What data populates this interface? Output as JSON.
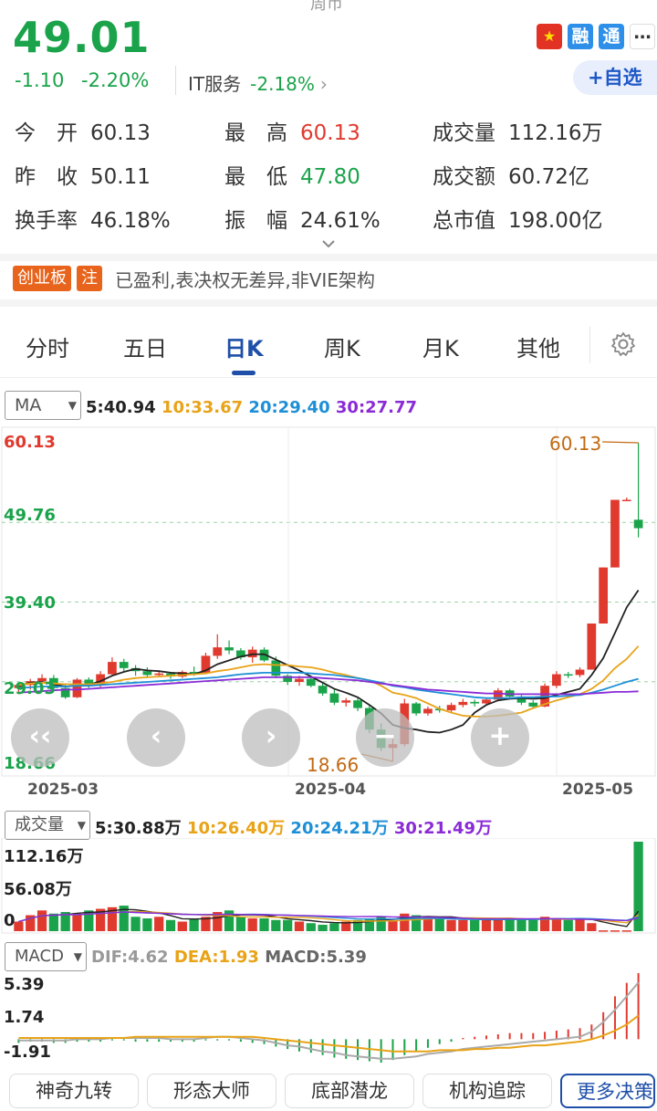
{
  "header": {
    "top_label": "周币",
    "price": "49.01",
    "change": "-1.10",
    "change_pct": "-2.20%",
    "sector_name": "IT服务",
    "sector_pct": "-2.18%",
    "sector_arrow": "›",
    "badge_rong": "融",
    "badge_tong": "通",
    "add_watchlist": "+自选"
  },
  "stats": {
    "open_label": "今　开",
    "open": "60.13",
    "high_label": "最　高",
    "high": "60.13",
    "volume_label": "成交量",
    "volume": "112.16万",
    "prev_label": "昨　收",
    "prev": "50.11",
    "low_label": "最　低",
    "low": "47.80",
    "amount_label": "成交额",
    "amount": "60.72亿",
    "turnover_label": "换手率",
    "turnover": "46.18%",
    "amplitude_label": "振　幅",
    "amplitude": "24.61%",
    "mktcap_label": "总市值",
    "mktcap": "198.00亿"
  },
  "board": {
    "tag1": "创业板",
    "tag2": "注",
    "text": "已盈利,表决权无差异,非VIE架构"
  },
  "tabs": [
    "分时",
    "五日",
    "日K",
    "周K",
    "月K",
    "其他"
  ],
  "ma_panel": {
    "selector": "MA",
    "ma5": "5:40.94",
    "ma10": "10:33.67",
    "ma20": "20:29.40",
    "ma30": "30:27.77"
  },
  "colors": {
    "up": "#e03a2f",
    "down": "#1aa34a",
    "ma5": "#222222",
    "ma10": "#e8a317",
    "ma20": "#1e8fd6",
    "ma30": "#8a2bd6"
  },
  "vol_panel": {
    "selector": "成交量",
    "ma5": "5:30.88万",
    "ma10": "10:26.40万",
    "ma20": "20:24.21万",
    "ma30": "30:21.49万",
    "ymax": "112.16万",
    "ymid": "56.08万",
    "ymin": "0"
  },
  "macd_panel": {
    "selector": "MACD",
    "dif": "DIF:4.62",
    "dea": "DEA:1.93",
    "macd": "MACD:5.39",
    "ymax": "5.39",
    "ymid": "1.74",
    "ymin": "-1.91"
  },
  "bottom_tabs": [
    "神奇九转",
    "形态大师",
    "底部潜龙",
    "机构追踪",
    "更多决策"
  ],
  "chart_data": {
    "type": "candlestick",
    "y_axis_labels": [
      "60.13",
      "49.76",
      "39.40",
      "29.03",
      "18.66"
    ],
    "ylim": [
      18.66,
      60.13
    ],
    "x_ticks": [
      "2025-03",
      "2025-04",
      "2025-05"
    ],
    "annotations": {
      "max": "60.13",
      "min": "18.66"
    },
    "candles": [
      [
        28.2,
        28.9,
        27.4,
        28.6
      ],
      [
        28.6,
        29.4,
        28.0,
        29.1
      ],
      [
        29.1,
        30.0,
        28.5,
        29.5
      ],
      [
        29.5,
        29.9,
        27.9,
        28.2
      ],
      [
        28.2,
        28.8,
        26.8,
        27.0
      ],
      [
        27.0,
        29.5,
        26.9,
        29.3
      ],
      [
        29.3,
        29.6,
        28.2,
        28.6
      ],
      [
        28.6,
        30.4,
        28.3,
        30.0
      ],
      [
        30.0,
        32.2,
        29.8,
        31.6
      ],
      [
        31.6,
        32.0,
        30.4,
        30.8
      ],
      [
        30.8,
        31.2,
        29.8,
        30.4
      ],
      [
        30.4,
        30.9,
        29.5,
        29.9
      ],
      [
        29.9,
        30.5,
        29.6,
        30.1
      ],
      [
        30.1,
        30.3,
        29.4,
        29.7
      ],
      [
        29.7,
        30.5,
        29.5,
        30.3
      ],
      [
        30.3,
        31.0,
        29.8,
        30.2
      ],
      [
        30.2,
        32.8,
        30.0,
        32.4
      ],
      [
        32.4,
        35.2,
        32.0,
        33.5
      ],
      [
        33.5,
        34.4,
        32.6,
        33.1
      ],
      [
        33.1,
        33.4,
        31.9,
        32.2
      ],
      [
        32.2,
        33.6,
        31.5,
        33.2
      ],
      [
        33.2,
        33.5,
        31.6,
        31.8
      ],
      [
        31.8,
        32.3,
        29.5,
        29.8
      ],
      [
        29.8,
        30.0,
        28.6,
        29.0
      ],
      [
        29.0,
        29.8,
        28.5,
        29.4
      ],
      [
        29.4,
        29.6,
        28.3,
        28.5
      ],
      [
        28.5,
        28.8,
        27.2,
        27.5
      ],
      [
        27.5,
        28.0,
        26.0,
        26.3
      ],
      [
        26.3,
        26.9,
        25.8,
        26.6
      ],
      [
        26.6,
        26.9,
        25.2,
        25.6
      ],
      [
        25.6,
        25.9,
        22.3,
        22.8
      ],
      [
        22.8,
        23.6,
        20.0,
        20.4
      ],
      [
        20.4,
        21.6,
        18.66,
        20.9
      ],
      [
        20.9,
        26.8,
        20.6,
        26.2
      ],
      [
        26.2,
        26.4,
        24.6,
        24.9
      ],
      [
        24.9,
        25.8,
        24.6,
        25.5
      ],
      [
        25.5,
        25.9,
        25.0,
        25.3
      ],
      [
        25.3,
        26.3,
        25.1,
        26.0
      ],
      [
        26.0,
        26.8,
        25.7,
        26.4
      ],
      [
        26.4,
        26.7,
        25.8,
        26.2
      ],
      [
        26.2,
        26.9,
        26.0,
        26.7
      ],
      [
        26.7,
        28.2,
        26.5,
        27.9
      ],
      [
        27.9,
        28.1,
        26.9,
        27.1
      ],
      [
        27.1,
        27.3,
        26.0,
        26.3
      ],
      [
        26.3,
        26.6,
        25.6,
        25.8
      ],
      [
        25.8,
        28.8,
        25.7,
        28.5
      ],
      [
        28.5,
        30.4,
        28.2,
        30.0
      ],
      [
        30.0,
        30.3,
        29.5,
        29.9
      ],
      [
        29.9,
        30.9,
        29.6,
        30.6
      ],
      [
        30.6,
        36.6,
        30.6,
        36.6
      ],
      [
        36.6,
        43.9,
        36.6,
        43.9
      ],
      [
        43.9,
        52.7,
        43.9,
        52.7
      ],
      [
        52.7,
        53.0,
        52.6,
        52.7
      ],
      [
        50.11,
        60.13,
        47.8,
        49.01
      ]
    ],
    "ma_lines": {
      "ma5": [
        28.5,
        28.9,
        29.0,
        28.7,
        28.4,
        28.5,
        28.6,
        29.1,
        29.8,
        30.3,
        30.7,
        30.5,
        30.4,
        30.2,
        30.1,
        30.0,
        30.5,
        31.3,
        31.8,
        32.3,
        32.6,
        32.6,
        31.9,
        31.2,
        30.5,
        29.7,
        28.9,
        28.1,
        27.6,
        27.0,
        26.0,
        24.9,
        23.4,
        23.0,
        22.8,
        22.5,
        22.4,
        22.8,
        23.4,
        25.0,
        26.0,
        26.6,
        26.8,
        26.9,
        26.8,
        26.9,
        27.3,
        27.7,
        28.1,
        29.9,
        32.1,
        35.4,
        38.7,
        40.94
      ],
      "ma10": [
        28.6,
        28.8,
        28.9,
        28.8,
        28.7,
        28.7,
        28.7,
        28.8,
        29.0,
        29.3,
        29.5,
        29.6,
        29.7,
        29.8,
        29.9,
        30.0,
        30.1,
        30.4,
        30.6,
        30.9,
        31.2,
        31.3,
        31.2,
        31.2,
        31.0,
        30.9,
        30.6,
        30.2,
        29.9,
        29.5,
        29.2,
        28.5,
        27.6,
        27.3,
        26.9,
        26.2,
        25.5,
        25.0,
        24.6,
        24.5,
        24.5,
        24.6,
        24.8,
        25.0,
        25.6,
        26.1,
        26.6,
        27.0,
        27.4,
        28.1,
        29.2,
        30.8,
        32.0,
        33.67
      ],
      "ma20": [
        28.2,
        28.3,
        28.4,
        28.4,
        28.4,
        28.5,
        28.5,
        28.6,
        28.7,
        28.8,
        28.9,
        29.0,
        29.1,
        29.2,
        29.3,
        29.4,
        29.5,
        29.6,
        29.8,
        30.0,
        30.1,
        30.2,
        30.2,
        30.2,
        30.2,
        30.1,
        30.0,
        29.9,
        29.7,
        29.5,
        29.2,
        28.9,
        28.5,
        28.3,
        28.0,
        27.8,
        27.6,
        27.4,
        27.2,
        27.0,
        26.9,
        26.9,
        26.9,
        27.0,
        27.0,
        27.1,
        27.1,
        27.2,
        27.3,
        27.6,
        28.0,
        28.5,
        29.0,
        29.4
      ],
      "ma30": [
        27.6,
        27.7,
        27.8,
        27.9,
        28.0,
        28.0,
        28.1,
        28.2,
        28.3,
        28.4,
        28.5,
        28.6,
        28.7,
        28.8,
        28.9,
        29.0,
        29.1,
        29.2,
        29.3,
        29.4,
        29.5,
        29.6,
        29.6,
        29.6,
        29.6,
        29.6,
        29.5,
        29.4,
        29.3,
        29.2,
        29.0,
        28.8,
        28.6,
        28.4,
        28.2,
        28.0,
        27.9,
        27.8,
        27.7,
        27.6,
        27.5,
        27.5,
        27.4,
        27.4,
        27.4,
        27.4,
        27.4,
        27.4,
        27.4,
        27.5,
        27.6,
        27.7,
        27.7,
        27.77
      ]
    },
    "volume": [
      12,
      20,
      26,
      22,
      24,
      20,
      26,
      28,
      30,
      32,
      18,
      16,
      18,
      14,
      12,
      16,
      18,
      24,
      26,
      18,
      16,
      16,
      14,
      14,
      12,
      10,
      8,
      10,
      12,
      14,
      16,
      18,
      14,
      22,
      20,
      18,
      16,
      14,
      14,
      14,
      14,
      16,
      16,
      14,
      14,
      18,
      16,
      14,
      16,
      10,
      1,
      1,
      1,
      112.16
    ],
    "macd_hist": [
      -0.3,
      -0.2,
      -0.2,
      -0.3,
      -0.3,
      -0.2,
      -0.2,
      -0.2,
      -0.1,
      -0.1,
      -0.2,
      -0.2,
      -0.2,
      -0.2,
      -0.2,
      -0.2,
      -0.1,
      -0.1,
      -0.1,
      -0.2,
      -0.3,
      -0.4,
      -0.6,
      -0.8,
      -1.0,
      -1.1,
      -1.3,
      -1.5,
      -1.6,
      -1.7,
      -1.8,
      -1.91,
      -1.7,
      -1.3,
      -1.0,
      -0.7,
      -0.4,
      -0.2,
      0.1,
      0.2,
      0.3,
      0.4,
      0.5,
      0.5,
      0.5,
      0.6,
      0.7,
      0.8,
      0.9,
      1.2,
      2.2,
      3.5,
      4.6,
      5.39
    ],
    "dif": [
      -0.1,
      -0.1,
      -0.1,
      -0.1,
      -0.1,
      0.0,
      0.0,
      0.0,
      0.1,
      0.1,
      0.1,
      0.1,
      0.1,
      0.0,
      0.0,
      0.0,
      0.1,
      0.2,
      0.2,
      0.1,
      0.0,
      -0.1,
      -0.3,
      -0.5,
      -0.6,
      -0.8,
      -1.0,
      -1.1,
      -1.3,
      -1.4,
      -1.5,
      -1.6,
      -1.6,
      -1.5,
      -1.4,
      -1.2,
      -1.1,
      -1.0,
      -0.8,
      -0.7,
      -0.6,
      -0.5,
      -0.4,
      -0.3,
      -0.2,
      -0.1,
      0.0,
      0.1,
      0.2,
      0.6,
      1.4,
      2.4,
      3.5,
      4.62
    ],
    "dea": [
      0.1,
      0.1,
      0.1,
      0.1,
      0.1,
      0.1,
      0.1,
      0.1,
      0.1,
      0.1,
      0.2,
      0.2,
      0.2,
      0.2,
      0.2,
      0.2,
      0.2,
      0.2,
      0.2,
      0.2,
      0.2,
      0.1,
      0.0,
      -0.1,
      -0.2,
      -0.3,
      -0.4,
      -0.5,
      -0.6,
      -0.7,
      -0.8,
      -0.9,
      -1.0,
      -1.0,
      -1.0,
      -1.0,
      -0.9,
      -0.9,
      -0.9,
      -0.8,
      -0.8,
      -0.7,
      -0.7,
      -0.6,
      -0.5,
      -0.5,
      -0.4,
      -0.3,
      -0.2,
      0.0,
      0.3,
      0.7,
      1.2,
      1.93
    ]
  }
}
